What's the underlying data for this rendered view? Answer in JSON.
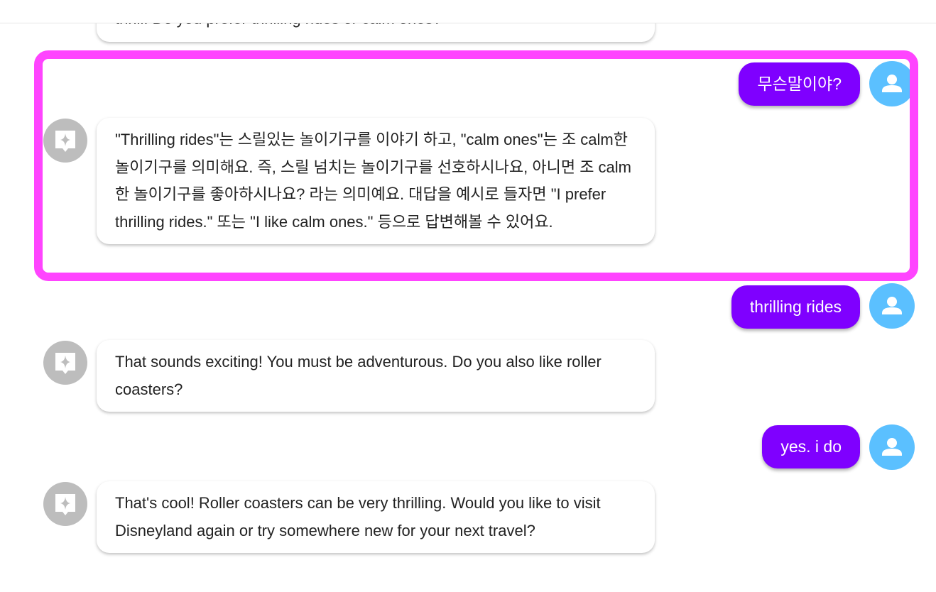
{
  "colors": {
    "user_bubble": "#7f00ff",
    "user_avatar": "#5bc0ff",
    "bot_avatar": "#bdbdbd",
    "highlight": "#ff44ff"
  },
  "icons": {
    "user_avatar": "person-icon",
    "bot_avatar": "sparkle-chat-icon"
  },
  "messages": [
    {
      "role": "bot",
      "text": "thrill. Do you prefer thrilling rides or calm ones?"
    },
    {
      "role": "user",
      "text": "무슨말이야?"
    },
    {
      "role": "bot",
      "text": "\"Thrilling rides\"는 스릴있는 놀이기구를 이야기 하고, \"calm ones\"는 조 calm한 놀이기구를 의미해요. 즉, 스릴 넘치는 놀이기구를 선호하시나요, 아니면 조 calm한 놀이기구를 좋아하시나요? 라는 의미예요. 대답을 예시로 들자면 \"I prefer thrilling rides.\" 또는 \"I like calm ones.\" 등으로 답변해볼 수 있어요."
    },
    {
      "role": "user",
      "text": "thrilling rides"
    },
    {
      "role": "bot",
      "text": "That sounds exciting! You must be adventurous. Do you also like roller coasters?"
    },
    {
      "role": "user",
      "text": "yes. i do"
    },
    {
      "role": "bot",
      "text": "That's cool! Roller coasters can be very thrilling. Would you like to visit Disneyland again or try somewhere new for your next travel?"
    }
  ]
}
